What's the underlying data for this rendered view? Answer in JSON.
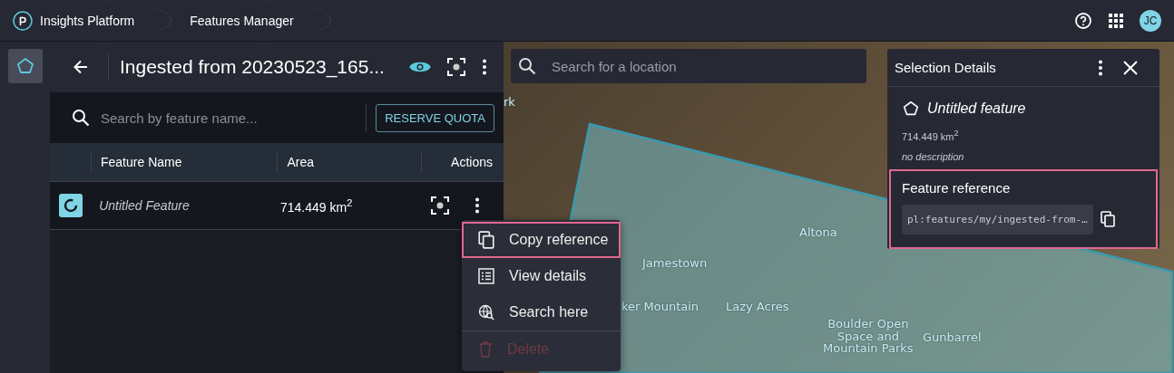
{
  "topbar": {
    "app_name": "Insights Platform",
    "breadcrumb": "Features Manager",
    "avatar": "JC"
  },
  "rail": {
    "items": [
      {
        "selected": true
      }
    ]
  },
  "panel": {
    "title": "Ingested from 20230523_165...",
    "visible": true,
    "search": {
      "placeholder": "Search by feature name..."
    },
    "reserve_button": "RESERVE QUOTA",
    "table": {
      "columns": [
        "Feature Name",
        "Area",
        "Actions"
      ],
      "rows": [
        {
          "name": "Untitled Feature",
          "area": "714.449 km$^{2}$"
        }
      ]
    }
  },
  "context_menu": {
    "items": [
      {
        "kind": "copy",
        "label": "Copy reference",
        "highlighted": true,
        "disabled": false
      },
      {
        "kind": "details",
        "label": "View details",
        "highlighted": false,
        "disabled": false
      },
      {
        "kind": "search",
        "label": "Search here",
        "highlighted": false,
        "disabled": false
      },
      {
        "kind": "delete",
        "label": "Delete",
        "highlighted": false,
        "disabled": true
      }
    ]
  },
  "map": {
    "search": {
      "placeholder": "Search for a location"
    },
    "labels": [
      "rk",
      "Altona",
      "Jamestown",
      "ker Mountain",
      "Lazy Acres",
      "Boulder Open\nSpace and\nMountain Parks",
      "Gunbarrel"
    ]
  },
  "details": {
    "title": "Selection Details",
    "feature_name": "Untitled feature",
    "area": "714.449 km$^{2}$",
    "description": "no description",
    "reference_label": "Feature reference",
    "reference_value": "pl:features/my/ingested-from-…",
    "highlighted": true
  }
}
